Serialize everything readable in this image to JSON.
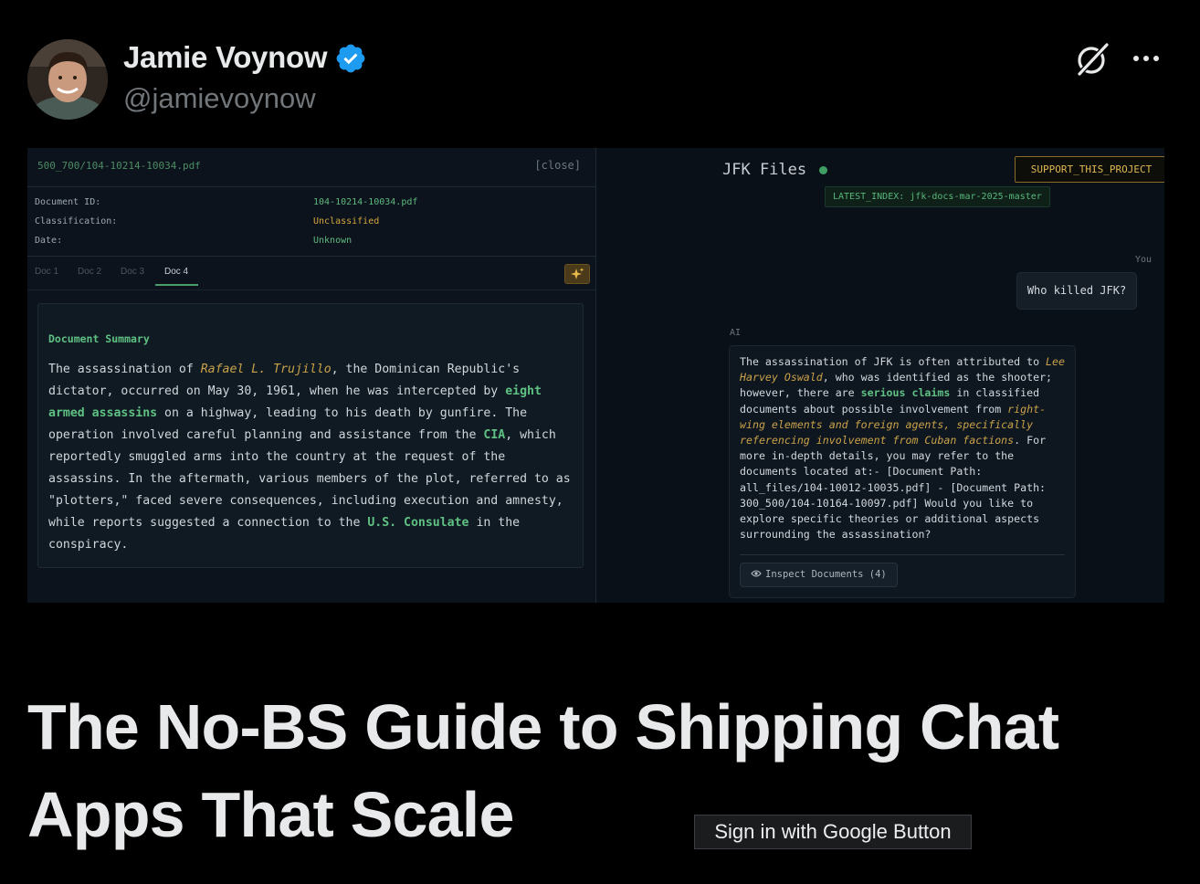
{
  "author": {
    "name": "Jamie Voynow",
    "handle": "@jamievoynow",
    "verified": true,
    "avatar": "avatar-photo"
  },
  "header_actions": {
    "grok_icon": "grok-slash-icon",
    "more_icon": "more-dots-icon"
  },
  "doc_panel": {
    "filename": "500_700/104-10214-10034.pdf",
    "close_label": "[close]",
    "meta": [
      {
        "key": "Document ID:",
        "value": "104-10214-10034.pdf",
        "color": "#5fb97e"
      },
      {
        "key": "Classification:",
        "value": "Unclassified",
        "color": "#d6a63c"
      },
      {
        "key": "Date:",
        "value": "Unknown",
        "color": "#5fb97e"
      }
    ],
    "tabs": [
      "Doc 1",
      "Doc 2",
      "Doc 3",
      "Doc 4"
    ],
    "active_tab": "Doc 4",
    "summary_title": "Document Summary",
    "summary": [
      {
        "t": "The assassination of "
      },
      {
        "t": "Rafael L. Trujillo",
        "s": "ital"
      },
      {
        "t": ", the Dominican Republic's dictator, occurred on May 30, 1961, when he was intercepted by "
      },
      {
        "t": "eight armed assassins",
        "s": "bold"
      },
      {
        "t": " on a highway, leading to his death by gunfire. The operation involved careful planning and assistance from the "
      },
      {
        "t": "CIA",
        "s": "bold"
      },
      {
        "t": ", which reportedly smuggled arms into the country at the request of the assassins. In the aftermath, various members of the plot, referred to as \"plotters,\" faced severe consequences, including execution and amnesty, while reports suggested a connection to the "
      },
      {
        "t": "U.S. Consulate",
        "s": "bold"
      },
      {
        "t": " in the conspiracy."
      }
    ]
  },
  "chat_panel": {
    "title": "JFK Files",
    "support_label": "SUPPORT_THIS_PROJECT",
    "latest_index": "LATEST_INDEX: jfk-docs-mar-2025-master",
    "user_label": "You",
    "user_message": "Who killed JFK?",
    "ai_label": "AI",
    "ai_message": [
      {
        "t": "The assassination of JFK is often attributed to "
      },
      {
        "t": "Lee Harvey Oswald",
        "s": "ital"
      },
      {
        "t": ", who was identified as the shooter; however, there are "
      },
      {
        "t": "serious claims",
        "s": "bold"
      },
      {
        "t": " in classified documents about possible involvement from "
      },
      {
        "t": "right-wing elements and foreign agents, specifically referencing involvement from Cuban factions",
        "s": "ital"
      },
      {
        "t": ". For more in-depth details, you may refer to the documents located at:- [Document Path: all_files/104-10012-10035.pdf] - [Document Path: 300_500/104-10164-10097.pdf] Would you like to explore specific theories or additional aspects surrounding the assassination?"
      }
    ],
    "inspect_label": "Inspect Documents (4)"
  },
  "article_title": "The No-BS Guide to Shipping Chat Apps That Scale",
  "tooltip": "Sign in with Google Button",
  "colors": {
    "accent_green": "#5fc183",
    "accent_gold": "#c9a24a",
    "verified_blue": "#1d9bf0"
  }
}
